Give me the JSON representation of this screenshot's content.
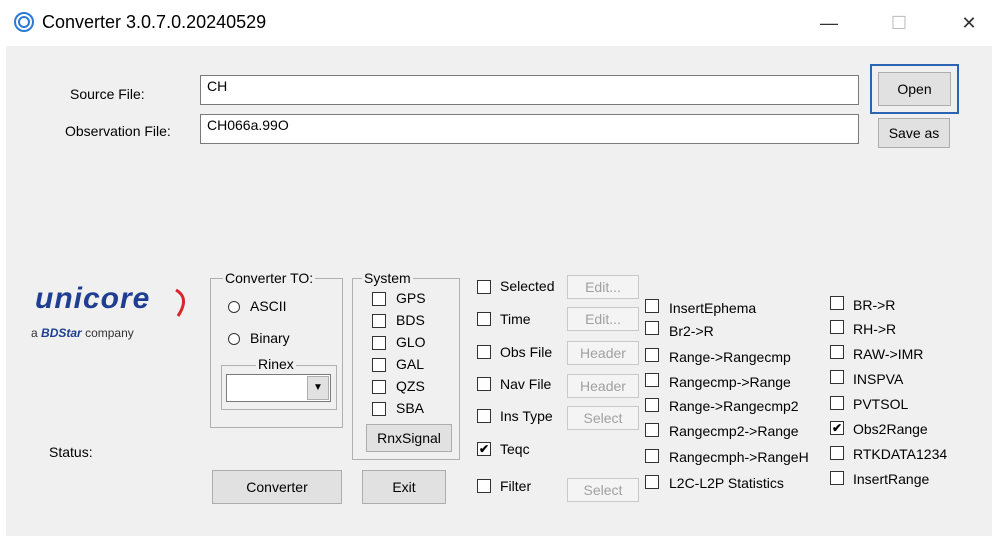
{
  "window": {
    "title": "Converter  3.0.7.0.20240529",
    "minimize_glyph": "—",
    "maximize_glyph": "☐",
    "close_glyph": "✕"
  },
  "files": {
    "source_label": "Source File:",
    "source_value": "CH",
    "observation_label": "Observation File:",
    "observation_value": "CH066a.99O",
    "open_label": "Open",
    "save_as_label": "Save as"
  },
  "logo": {
    "brand": "unicore",
    "tagline_prefix": "a",
    "tagline_brand": "BDStar",
    "tagline_suffix": "company"
  },
  "converter_to": {
    "title": "Converter TO:",
    "ascii_label": "ASCII",
    "binary_label": "Binary",
    "rinex_title": "Rinex",
    "rinex_value": ""
  },
  "system": {
    "title": "System",
    "items": [
      "GPS",
      "BDS",
      "GLO",
      "GAL",
      "QZS",
      "SBA"
    ],
    "rnx_signal_label": "RnxSignal"
  },
  "options": {
    "selected_label": "Selected",
    "selected_btn": "Edit...",
    "time_label": "Time",
    "time_btn": "Edit...",
    "obs_file_label": "Obs File",
    "obs_file_btn": "Header",
    "nav_file_label": "Nav File",
    "nav_file_btn": "Header",
    "ins_type_label": "Ins Type",
    "ins_type_btn": "Select",
    "teqc_label": "Teqc",
    "teqc_checked": true,
    "filter_label": "Filter",
    "filter_btn": "Select"
  },
  "conversions_col1": [
    "InsertEphema",
    "Br2->R",
    "Range->Rangecmp",
    "Rangecmp->Range",
    "Range->Rangecmp2",
    "Rangecmp2->Range",
    "Rangecmph->RangeH",
    "L2C-L2P Statistics"
  ],
  "conversions_col2": [
    "BR->R",
    "RH->R",
    "RAW->IMR",
    "INSPVA",
    "PVTSOL",
    "Obs2Range",
    "RTKDATA1234",
    "InsertRange"
  ],
  "conversions_col2_checked": "Obs2Range",
  "status_label": "Status:",
  "actions": {
    "converter_label": "Converter",
    "exit_label": "Exit"
  },
  "colors": {
    "accent": "#2b64b3",
    "logo_blue": "#1f3e91",
    "logo_red": "#d9262c"
  }
}
